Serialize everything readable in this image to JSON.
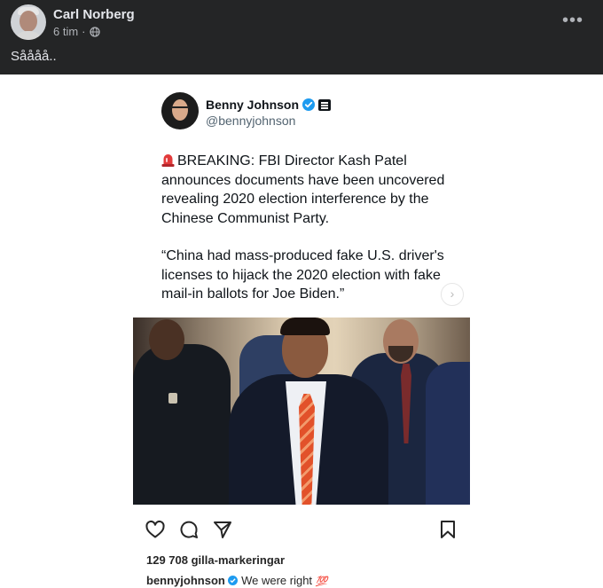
{
  "post": {
    "author": "Carl Norberg",
    "time": "6 tim",
    "separator": "·",
    "text": "Såååå..",
    "more_icon": "more-horizontal-icon",
    "privacy_icon": "globe-icon"
  },
  "tweet": {
    "name": "Benny Johnson",
    "handle": "@bennyjohnson",
    "verified_icon": "verified-badge-icon",
    "affiliate_icon": "affiliate-badge-icon",
    "emoji_icon": "siren-icon",
    "para1": "BREAKING: FBI Director Kash Patel announces documents have been uncovered revealing 2020 election interference by the Chinese Communist Party.",
    "para2": "“China had mass-produced fake U.S. driver's licenses to hijack the 2020 election with fake mail-in ballots for Joe Biden.”"
  },
  "instagram": {
    "likes": "129 708 gilla-markeringar",
    "caption_user": "bennyjohnson",
    "caption_text": "We were right",
    "caption_emoji": "💯",
    "next_icon": "chevron-right-icon",
    "actions": [
      "heart-icon",
      "comment-icon",
      "share-icon",
      "bookmark-icon"
    ]
  },
  "colors": {
    "fb_header_bg": "#242526",
    "verified_blue": "#1d9bf0",
    "text_dark": "#0f1419"
  }
}
